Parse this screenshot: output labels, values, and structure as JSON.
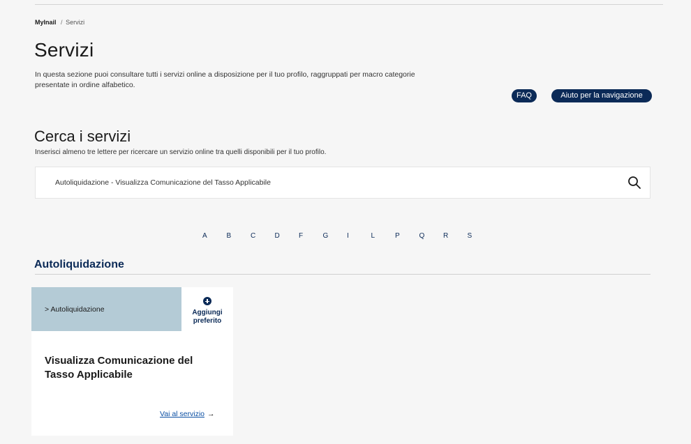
{
  "breadcrumb": {
    "home": "MyInail",
    "separator": "/",
    "current": "Servizi"
  },
  "page": {
    "title": "Servizi",
    "intro": "In questa sezione puoi consultare tutti i servizi online a disposizione per il tuo profilo, raggruppati per macro categorie presentate in ordine alfabetico."
  },
  "actions": {
    "faq": "FAQ",
    "help": "Aiuto per la navigazione"
  },
  "search": {
    "title": "Cerca i servizi",
    "hint": "Inserisci almeno tre lettere per ricercare un servizio online tra quelli disponibili per il tuo profilo.",
    "value": "Autoliquidazione - Visualizza Comunicazione del Tasso Applicabile",
    "icon": "search-icon"
  },
  "alphabet": [
    "A",
    "B",
    "C",
    "D",
    "F",
    "G",
    "I",
    "L",
    "P",
    "Q",
    "R",
    "S"
  ],
  "section": {
    "title": "Autoliquidazione"
  },
  "card": {
    "category": "> Autoliquidazione",
    "favorite_line1": "Aggiungi",
    "favorite_line2": "preferito",
    "favorite_icon": "plus-circle-icon",
    "title": "Visualizza Comunicazione del Tasso Applicabile",
    "link": "Vai al servizio",
    "link_arrow": "→"
  },
  "colors": {
    "primary": "#0b2a57",
    "card_header": "#b4cbd6",
    "link": "#0b4fa3",
    "background": "#f6f6f6"
  }
}
